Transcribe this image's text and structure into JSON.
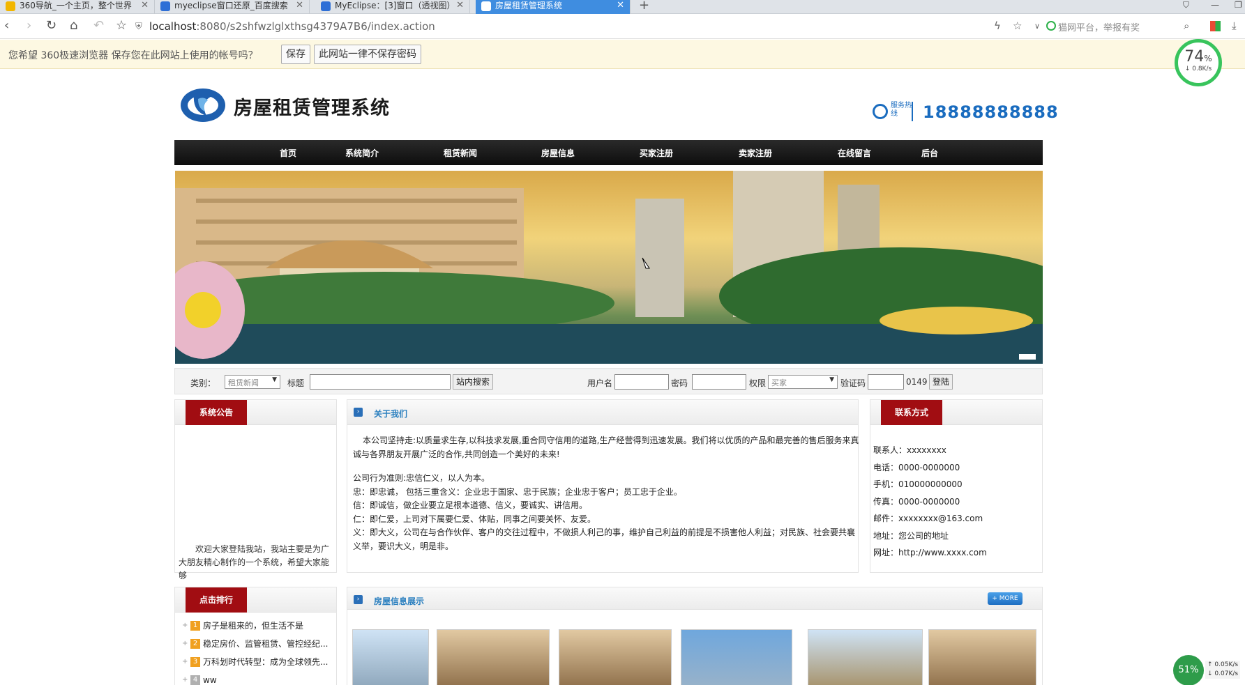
{
  "browser": {
    "tabs": [
      {
        "title": "360导航_一个主页，整个世界",
        "active": false
      },
      {
        "title": "myeclipse窗口还原_百度搜索",
        "active": false
      },
      {
        "title": "MyEclipse：[3]窗口（透视图）",
        "active": false
      },
      {
        "title": "房屋租赁管理系统",
        "active": true
      }
    ],
    "new_tab_icon": "plus-icon",
    "url_host": "localhost",
    "url_rest": ":8080/s2shfwzlglxthsg4379A7B6/index.action",
    "promo_text": "猫网平台，举报有奖"
  },
  "infobar": {
    "message": "您希望 360极速浏览器 保存您在此网站上使用的帐号吗？",
    "save_label": "保存",
    "never_label": "此网站一律不保存密码"
  },
  "speed_widget": {
    "percent": "74",
    "percent_unit": "%",
    "rate": "↓ 0.8K/s"
  },
  "site": {
    "title": "房屋租赁管理系统",
    "hotline_label": "服务热线",
    "hotline_number": "18888888888"
  },
  "nav": [
    "首页",
    "系统简介",
    "租赁新闻",
    "房屋信息",
    "买家注册",
    "卖家注册",
    "在线留言",
    "后台"
  ],
  "search": {
    "category_label": "类别：",
    "category_value": "租赁新闻",
    "title_label": "标题",
    "search_button": "站内搜索",
    "username_label": "用户名",
    "password_label": "密码",
    "role_label": "权限",
    "role_value": "买家",
    "captcha_label": "验证码",
    "captcha_code": "0149",
    "login_button": "登陆"
  },
  "notice": {
    "title": "系统公告",
    "text": "欢迎大家登陆我站，我站主要是为广大朋友精心制作的一个系统，希望大家能够"
  },
  "about": {
    "title": "关于我们",
    "intro": "本公司坚持走:以质量求生存,以科技求发展,重合同守信用的道路,生产经营得到迅速发展。我们将以优质的产品和最完善的售后服务来真诚与各界朋友开展广泛的合作,共同创造一个美好的未来!",
    "lines": [
      "公司行为准则:忠信仁义，以人为本。",
      "忠：即忠诚， 包括三重含义：企业忠于国家、忠于民族；企业忠于客户；员工忠于企业。",
      "信：即诚信，做企业要立足根本道德、信义，要诚实、讲信用。",
      "仁：即仁爱，上司对下属要仁爱、体贴，同事之间要关怀、友爱。",
      "义：即大义，公司在与合作伙伴、客户的交往过程中，不做损人利己的事，维护自己利益的前提是不损害他人利益；对民族、社会要共襄义举，要识大义，明是非。"
    ]
  },
  "contact": {
    "title": "联系方式",
    "lines": [
      "联系人：xxxxxxxx",
      "电话：0000-0000000",
      "手机：010000000000",
      "传真：0000-0000000",
      "邮件：xxxxxxxx@163.com",
      "地址：您公司的地址",
      "网址：http://www.xxxx.com"
    ]
  },
  "ranking": {
    "title": "点击排行",
    "items": [
      {
        "num": "1",
        "text": "房子是租来的，但生活不是"
      },
      {
        "num": "2",
        "text": "稳定房价、监管租赁、管控经纪..."
      },
      {
        "num": "3",
        "text": "万科划时代转型：成为全球领先..."
      },
      {
        "num": "4",
        "text": "ww"
      }
    ]
  },
  "houses": {
    "title": "房屋信息展示",
    "more_label": "+ MORE",
    "count": 6
  },
  "bottom_widget": {
    "percent": "51%",
    "up": "↑ 0.05K/s",
    "down": "↓ 0.07K/s"
  }
}
